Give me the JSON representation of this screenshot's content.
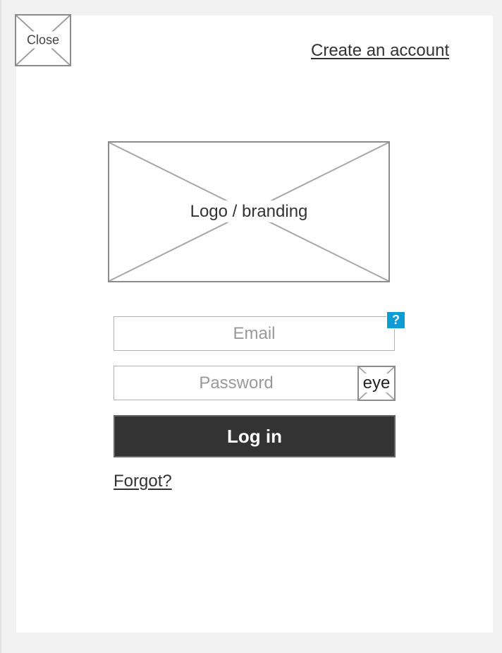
{
  "header": {
    "close_label": "Close",
    "close_icon": "image-placeholder-icon",
    "create_account_label": "Create an account"
  },
  "branding": {
    "logo_label": "Logo / branding"
  },
  "form": {
    "email_placeholder": "Email",
    "email_value": "",
    "help_label": "?",
    "password_placeholder": "Password",
    "password_value": "",
    "eye_label": "eye",
    "login_label": "Log in",
    "forgot_label": "Forgot?"
  },
  "colors": {
    "page_background": "#f2f2f2",
    "card_background": "#ffffff",
    "primary_button": "#333333",
    "help_badge": "#0c9dd6",
    "placeholder_border": "#8c8c8c"
  }
}
